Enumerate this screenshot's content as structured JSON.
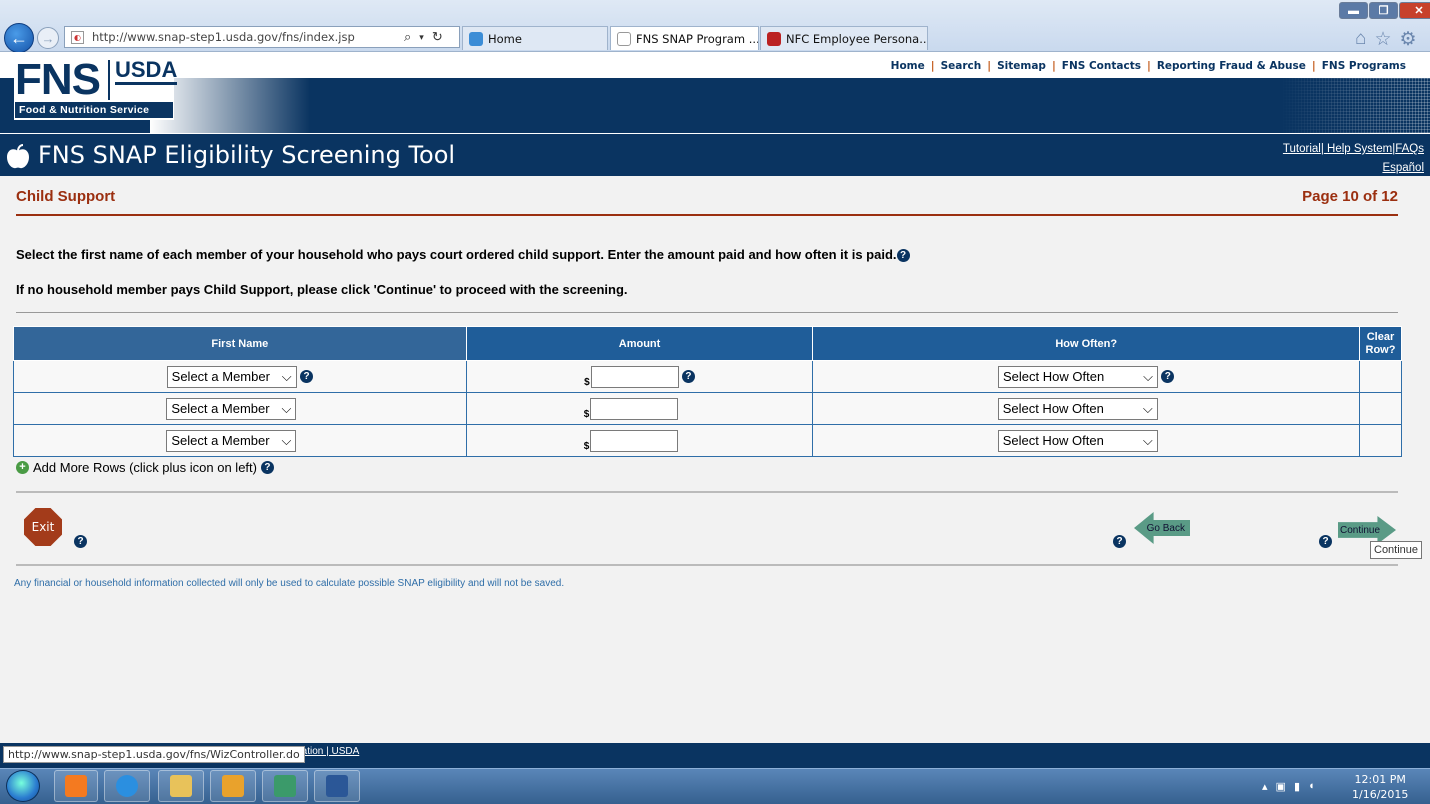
{
  "browser": {
    "address": "http://www.snap-step1.usda.gov/fns/index.jsp",
    "tabs": [
      {
        "label": "Home"
      },
      {
        "label": "FNS SNAP Program ...",
        "close": "×"
      },
      {
        "label": "NFC Employee Persona..."
      }
    ]
  },
  "site": {
    "logo_fns": "FNS",
    "logo_usda": "USDA",
    "logo_sub": "Food & Nutrition Service",
    "top_links": [
      "Home",
      "Search",
      "Sitemap",
      "FNS Contacts",
      "Reporting Fraud & Abuse",
      "FNS Programs"
    ],
    "top_link_sep": "|"
  },
  "tool": {
    "title": "FNS SNAP Eligibility Screening Tool",
    "help_links": {
      "tutorial": "Tutorial",
      "sep": "|",
      "help": " Help System",
      "faqs": "FAQs",
      "espanol": "Español"
    }
  },
  "page": {
    "heading": "Child Support",
    "page_indicator": "Page 10 of 12",
    "instruction1": "Select the first name of each member of your household who pays court ordered child support. Enter the amount paid and how often it is paid.",
    "instruction2": "If no household member pays Child Support, please click 'Continue' to proceed with the screening.",
    "table": {
      "headers": {
        "first_name": "First Name",
        "amount": "Amount",
        "how_often": "How Often?",
        "clear": "Clear Row?"
      },
      "currency": "$",
      "rows": [
        {
          "member": "Select a Member",
          "amount": "",
          "how_often": "Select How Often"
        },
        {
          "member": "Select a Member",
          "amount": "",
          "how_often": "Select How Often"
        },
        {
          "member": "Select a Member",
          "amount": "",
          "how_often": "Select How Often"
        }
      ]
    },
    "add_rows": "Add More Rows (click plus icon on left)",
    "buttons": {
      "exit": "Exit",
      "go_back": "Go Back",
      "continue": "Continue"
    },
    "tooltip": "Continue",
    "disclaimer": "Any financial or household information collected will only be used to calculate possible SNAP eligibility and will not be saved."
  },
  "footer": {
    "links": "rimination | USDA",
    "status_url": "http://www.snap-step1.usda.gov/fns/WizController.do"
  },
  "taskbar": {
    "time": "12:01 PM",
    "date": "1/16/2015"
  },
  "colors": {
    "navy": "#0a3461",
    "header_blue": "#2f6ea8",
    "heading_red": "#9b2f10"
  }
}
